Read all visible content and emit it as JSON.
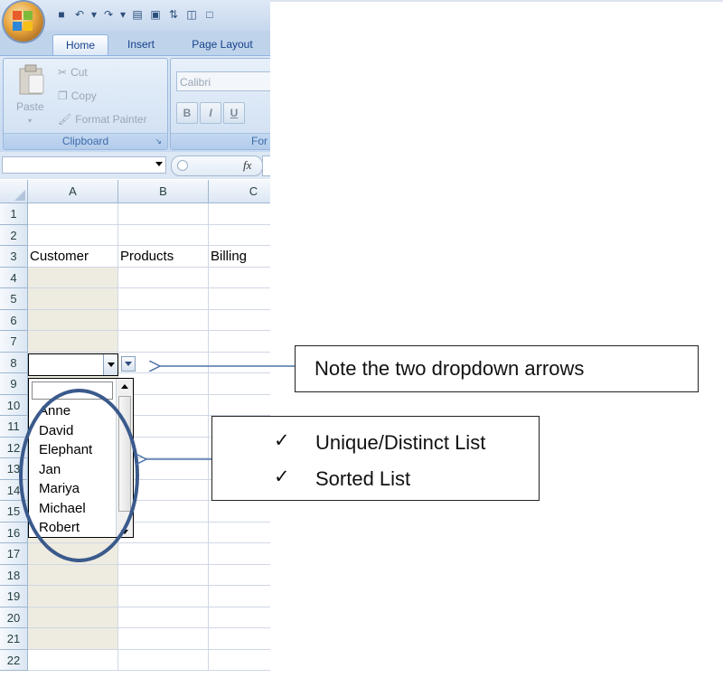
{
  "qat": {
    "icons": [
      "save-icon",
      "undo-icon",
      "redo-icon",
      "print-preview-icon",
      "spelling-icon",
      "sort-icon",
      "camera-icon",
      "new-document-icon"
    ]
  },
  "ribbon": {
    "tabs": [
      {
        "label": "Home"
      },
      {
        "label": "Insert"
      },
      {
        "label": "Page Layout"
      }
    ],
    "clipboard": {
      "paste": "Paste",
      "cut": "Cut",
      "copy": "Copy",
      "format_painter": "Format Painter",
      "group_label": "Clipboard"
    },
    "font": {
      "font_name": "Calibri",
      "bold": "B",
      "italic": "I",
      "underline": "U",
      "group_label_partial": "For"
    }
  },
  "formula_bar": {
    "name_box": "",
    "fx_label": "fx"
  },
  "sheet": {
    "columns": [
      "A",
      "B",
      "C"
    ],
    "rows": [
      "1",
      "2",
      "3",
      "4",
      "5",
      "6",
      "7",
      "8",
      "9",
      "10",
      "11",
      "12",
      "13",
      "14",
      "15",
      "16",
      "17",
      "18",
      "19",
      "20",
      "21",
      "22"
    ],
    "headers": {
      "customer": "Customer",
      "products": "Products",
      "billing": "Billing"
    }
  },
  "dropdown": {
    "value": "",
    "items": [
      "Anne",
      "David",
      "Elephant",
      "Jan",
      "Mariya",
      "Michael",
      "Robert"
    ]
  },
  "annotations": {
    "callout1": "Note the two dropdown arrows",
    "checkmark": "✓",
    "list_features": [
      "Unique/Distinct List",
      "Sorted List"
    ]
  },
  "colors": {
    "shaded_cell": "#eeece1",
    "annotation_ellipse": "#3b5a8c",
    "arrow": "#4f74aa"
  }
}
